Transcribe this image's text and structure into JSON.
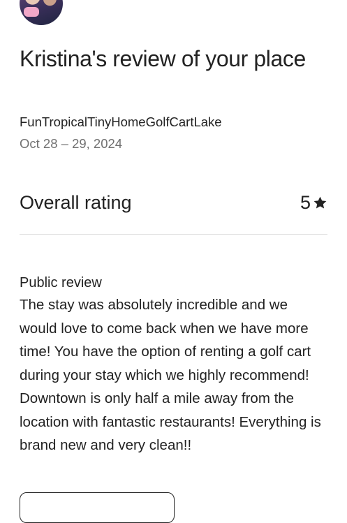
{
  "review": {
    "title": "Kristina's review of your place",
    "listing_name": "FunTropicalTinyHomeGolfCartLake",
    "stay_dates": "Oct 28 – 29, 2024",
    "overall_rating_label": "Overall rating",
    "overall_rating_value": "5",
    "rating_icon": "star-icon",
    "public_review_heading": "Public review",
    "public_review_text": "The stay was absolutely incredible and we would love to come back when we have more time! You have the option of renting a golf cart during your stay which we highly recommend! Downtown is only half a mile away from the location with fantastic restaurants! Everything is brand new and very clean!!"
  },
  "colors": {
    "text_primary": "#222222",
    "text_secondary": "#717171",
    "divider": "#dddddd"
  }
}
